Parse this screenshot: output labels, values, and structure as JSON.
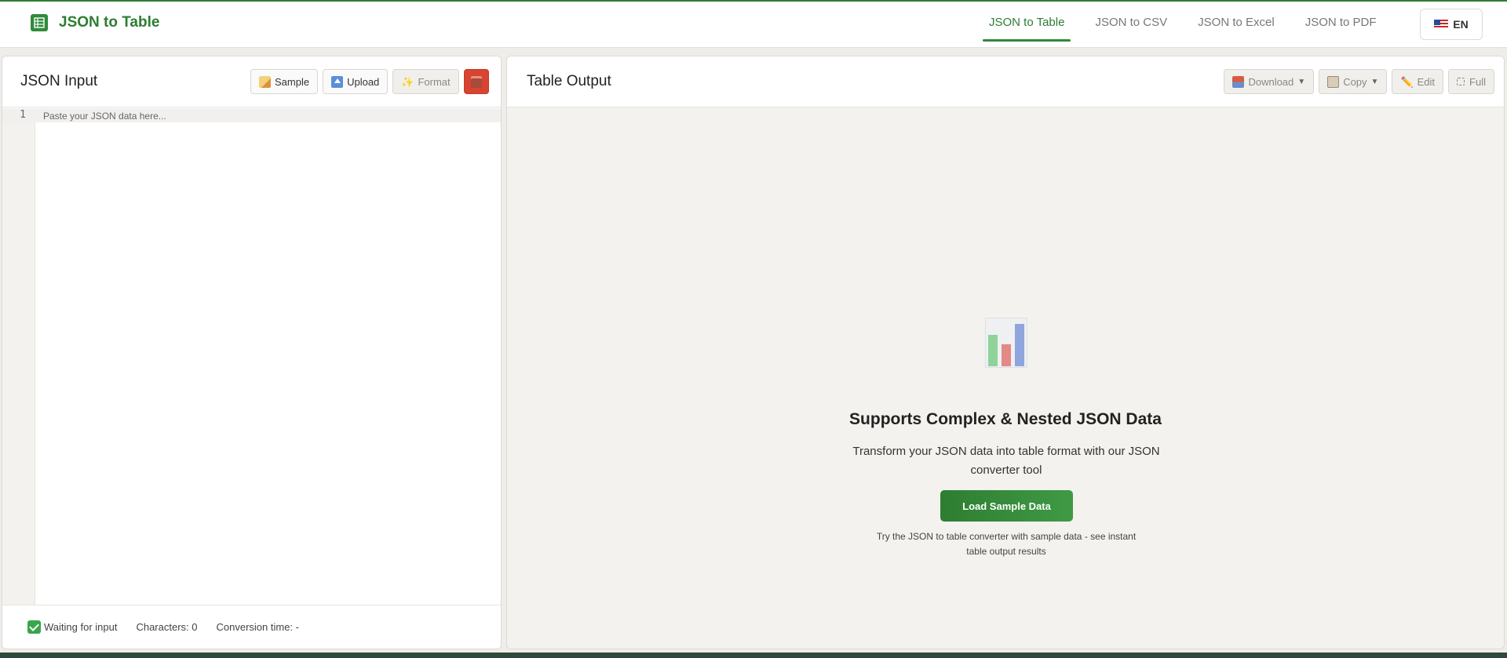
{
  "header": {
    "title": "JSON to Table",
    "nav": [
      {
        "label": "JSON to Table",
        "active": true
      },
      {
        "label": "JSON to CSV",
        "active": false
      },
      {
        "label": "JSON to Excel",
        "active": false
      },
      {
        "label": "JSON to PDF",
        "active": false
      }
    ],
    "language": "EN"
  },
  "input_panel": {
    "title": "JSON Input",
    "buttons": {
      "sample": "Sample",
      "upload": "Upload",
      "format": "Format"
    },
    "editor": {
      "line_number": "1",
      "placeholder": "Paste your JSON data here..."
    },
    "status": {
      "state": "Waiting for input",
      "characters": "Characters: 0",
      "conversion_time": "Conversion time: -"
    }
  },
  "output_panel": {
    "title": "Table Output",
    "buttons": {
      "download": "Download",
      "copy": "Copy",
      "edit": "Edit",
      "full": "Full"
    },
    "empty_state": {
      "title": "Supports Complex & Nested JSON Data",
      "description": "Transform your JSON data into table format with our JSON converter tool",
      "button": "Load Sample Data",
      "hint": "Try the JSON to table converter with sample data - see instant table output results"
    }
  },
  "colors": {
    "accent": "#2e7d32",
    "danger": "#d84332",
    "background": "#efede9"
  }
}
